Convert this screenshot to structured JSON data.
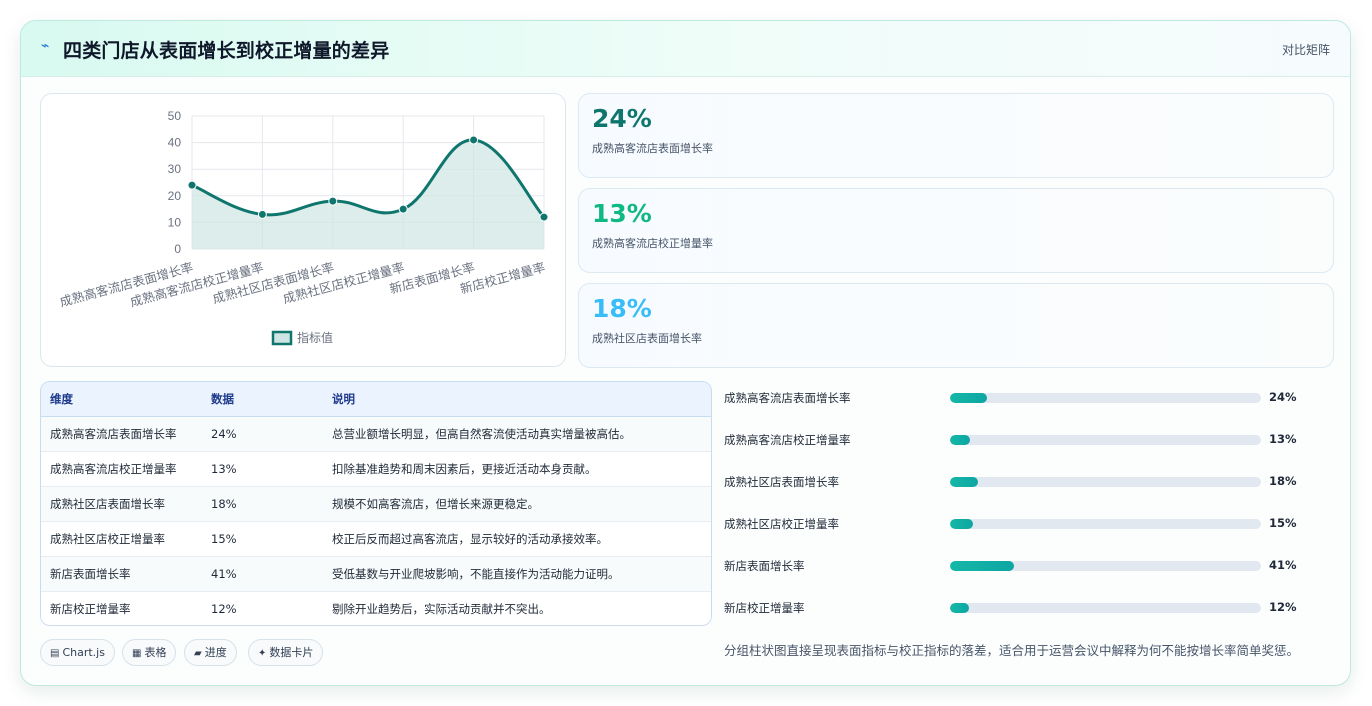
{
  "header": {
    "icon": "bolt-icon",
    "title": "四类门店从表面增长到校正增量的差异",
    "right_label": "对比矩阵"
  },
  "chart_data": {
    "type": "area",
    "categories": [
      "成熟高客流店表面增长率",
      "成熟高客流店校正增量率",
      "成熟社区店表面增长率",
      "成熟社区店校正增量率",
      "新店表面增长率",
      "新店校正增量率"
    ],
    "series": [
      {
        "name": "指标值",
        "values": [
          24,
          13,
          18,
          15,
          41,
          12
        ]
      }
    ],
    "ylim": [
      0,
      50
    ],
    "yticks": [
      0,
      10,
      20,
      30,
      40,
      50
    ],
    "grid": true,
    "legend": "bottom",
    "color": "#0f766e",
    "fill": "#cfe5e3"
  },
  "stats": [
    {
      "value": "24%",
      "label": "成熟高客流店表面增长率",
      "color": "#0f766e"
    },
    {
      "value": "13%",
      "label": "成熟高客流店校正增量率",
      "color": "#10b981"
    },
    {
      "value": "18%",
      "label": "成熟社区店表面增长率",
      "color": "#38bdf8"
    }
  ],
  "table": {
    "headers": [
      "维度",
      "数据",
      "说明"
    ],
    "rows": [
      [
        "成熟高客流店表面增长率",
        "24%",
        "总营业额增长明显，但高自然客流使活动真实增量被高估。"
      ],
      [
        "成熟高客流店校正增量率",
        "13%",
        "扣除基准趋势和周末因素后，更接近活动本身贡献。"
      ],
      [
        "成熟社区店表面增长率",
        "18%",
        "规模不如高客流店，但增长来源更稳定。"
      ],
      [
        "成熟社区店校正增量率",
        "15%",
        "校正后反而超过高客流店，显示较好的活动承接效率。"
      ],
      [
        "新店表面增长率",
        "41%",
        "受低基数与开业爬坡影响，不能直接作为活动能力证明。"
      ],
      [
        "新店校正增量率",
        "12%",
        "剔除开业趋势后，实际活动贡献并不突出。"
      ]
    ]
  },
  "progress": [
    {
      "label": "成熟高客流店表面增长率",
      "value": 24,
      "display": "24%"
    },
    {
      "label": "成熟高客流店校正增量率",
      "value": 13,
      "display": "13%"
    },
    {
      "label": "成熟社区店表面增长率",
      "value": 18,
      "display": "18%"
    },
    {
      "label": "成熟社区店校正增量率",
      "value": 15,
      "display": "15%"
    },
    {
      "label": "新店表面增长率",
      "value": 41,
      "display": "41%"
    },
    {
      "label": "新店校正增量率",
      "value": 12,
      "display": "12%"
    }
  ],
  "progress_max": 200,
  "note": "分组柱状图直接呈现表面指标与校正指标的落差，适合用于运营会议中解释为何不能按增长率简单奖惩。",
  "chips": [
    {
      "icon": "chart-icon",
      "label": "Chart.js"
    },
    {
      "icon": "table-icon",
      "label": "表格"
    },
    {
      "icon": "progress-icon",
      "label": "进度"
    },
    {
      "icon": "card-icon",
      "label": "数据卡片"
    }
  ]
}
